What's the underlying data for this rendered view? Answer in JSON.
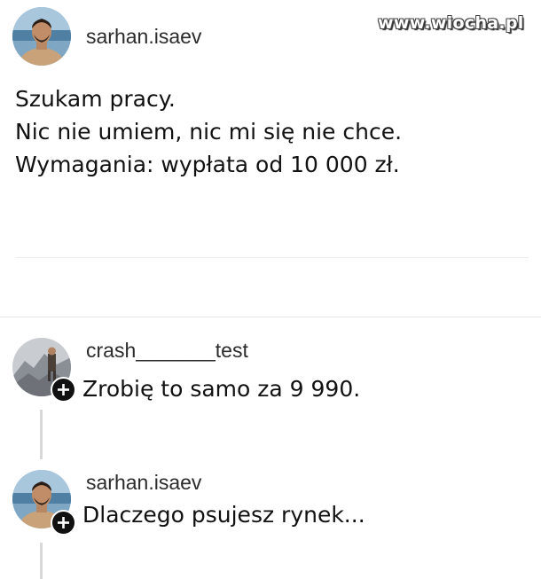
{
  "watermark": {
    "text": "www.wiocha.pl"
  },
  "post": {
    "username": "sarhan.isaev",
    "lines": [
      "Szukam pracy.",
      "Nic nie umiem, nic mi się nie chce.",
      "Wymagania: wypłata od 10 000 zł."
    ]
  },
  "comments": [
    {
      "username": "crash_______test",
      "text": "Zrobię to samo za 9 990.",
      "avatar_icon": "mountain-photo"
    },
    {
      "username": "sarhan.isaev",
      "text": "Dlaczego psujesz rynek...",
      "avatar_icon": "sea-photo"
    }
  ],
  "colors": {
    "background": "#ffffff",
    "text": "#111111",
    "badge": "#111111",
    "divider": "#e6e6e6"
  }
}
